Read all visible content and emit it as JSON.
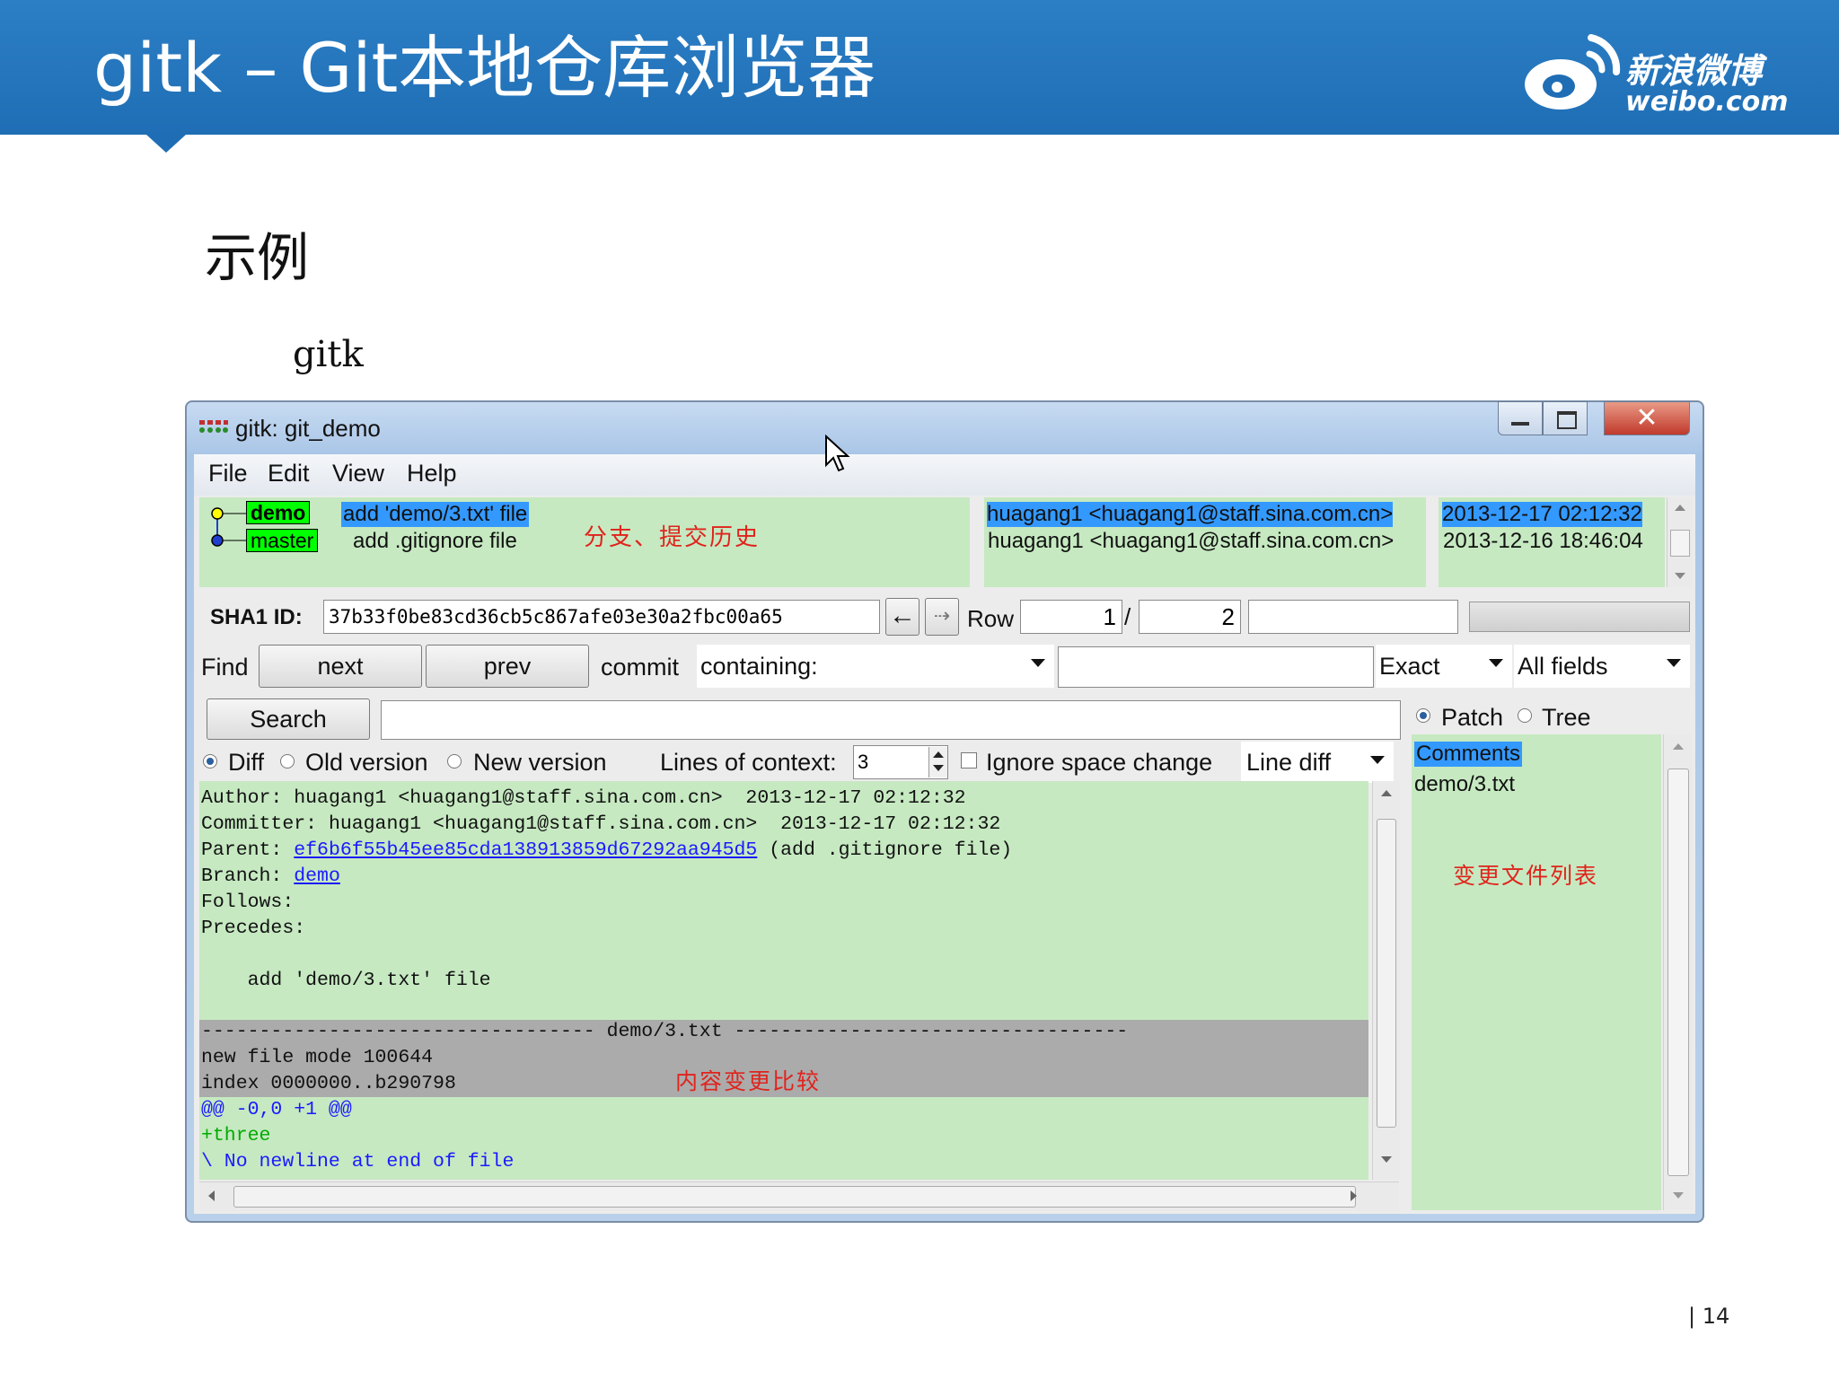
{
  "slide": {
    "title": "gitk – Git本地仓库浏览器",
    "section_heading": "示例",
    "sub_label": "gitk",
    "page_number": "| 14",
    "logo": {
      "name": "weibo-logo",
      "text_cn": "新浪微博",
      "text_en": "weibo.com"
    },
    "header_color": "#1f6eb5"
  },
  "window": {
    "title": "gitk: git_demo",
    "menu": [
      "File",
      "Edit",
      "View",
      "Help"
    ]
  },
  "commits": [
    {
      "branches": [
        "demo",
        "master"
      ],
      "subject": "add 'demo/3.txt' file",
      "author": "huagang1 <huagang1@staff.sina.com.cn>",
      "date": "2013-12-17 02:12:32",
      "selected": true
    },
    {
      "branches": [],
      "subject": "add .gitignore file",
      "author": "huagang1 <huagang1@staff.sina.com.cn>",
      "date": "2013-12-16 18:46:04",
      "selected": false
    }
  ],
  "annotations": {
    "history": "分支、提交历史",
    "diff": "内容变更比较",
    "file_list": "变更文件列表"
  },
  "sha_row": {
    "label": "SHA1 ID:",
    "value": "37b33f0be83cd36cb5c867afe03e30a2fbc00a65",
    "row_label": "Row",
    "row_current": "1",
    "row_sep": "/",
    "row_total": "2"
  },
  "find_row": {
    "label": "Find",
    "next": "next",
    "prev": "prev",
    "commit_label": "commit",
    "containing": "containing:",
    "match": "Exact",
    "fields": "All fields"
  },
  "search": {
    "button": "Search",
    "patch": "Patch",
    "tree": "Tree",
    "patch_selected": true
  },
  "diff_options": {
    "diff": "Diff",
    "old": "Old version",
    "new": "New version",
    "context_label": "Lines of context:",
    "context_value": "3",
    "ignore_space": "Ignore space change",
    "line_diff": "Line diff"
  },
  "details": {
    "author_label": "Author:",
    "author": "huagang1 <huagang1@staff.sina.com.cn>  2013-12-17 02:12:32",
    "committer_label": "Committer:",
    "committer": "huagang1 <huagang1@staff.sina.com.cn>  2013-12-17 02:12:32",
    "parent_label": "Parent:",
    "parent_sha": "ef6b6f55b45ee85cda138913859d67292aa945d5",
    "parent_subject": "(add .gitignore file)",
    "branch_label": "Branch:",
    "branch": "demo",
    "follows_label": "Follows:",
    "precedes_label": "Precedes:",
    "message": "    add 'demo/3.txt' file"
  },
  "diff": {
    "file_header": "---------------------------------- demo/3.txt ----------------------------------",
    "mode": "new file mode 100644",
    "index": "index 0000000..b290798",
    "hunk": "@@ -0,0 +1 @@",
    "added": "+three",
    "no_newline": "\\ No newline at end of file"
  },
  "files": {
    "selected": "Comments",
    "items": [
      "demo/3.txt"
    ]
  },
  "colors": {
    "pane_green": "#c6e9c1",
    "selection": "#3399ff",
    "branch_tag": "#00ff00",
    "annotation": "#e0231c",
    "link": "#1a1aff",
    "added_line": "#00aa00"
  }
}
